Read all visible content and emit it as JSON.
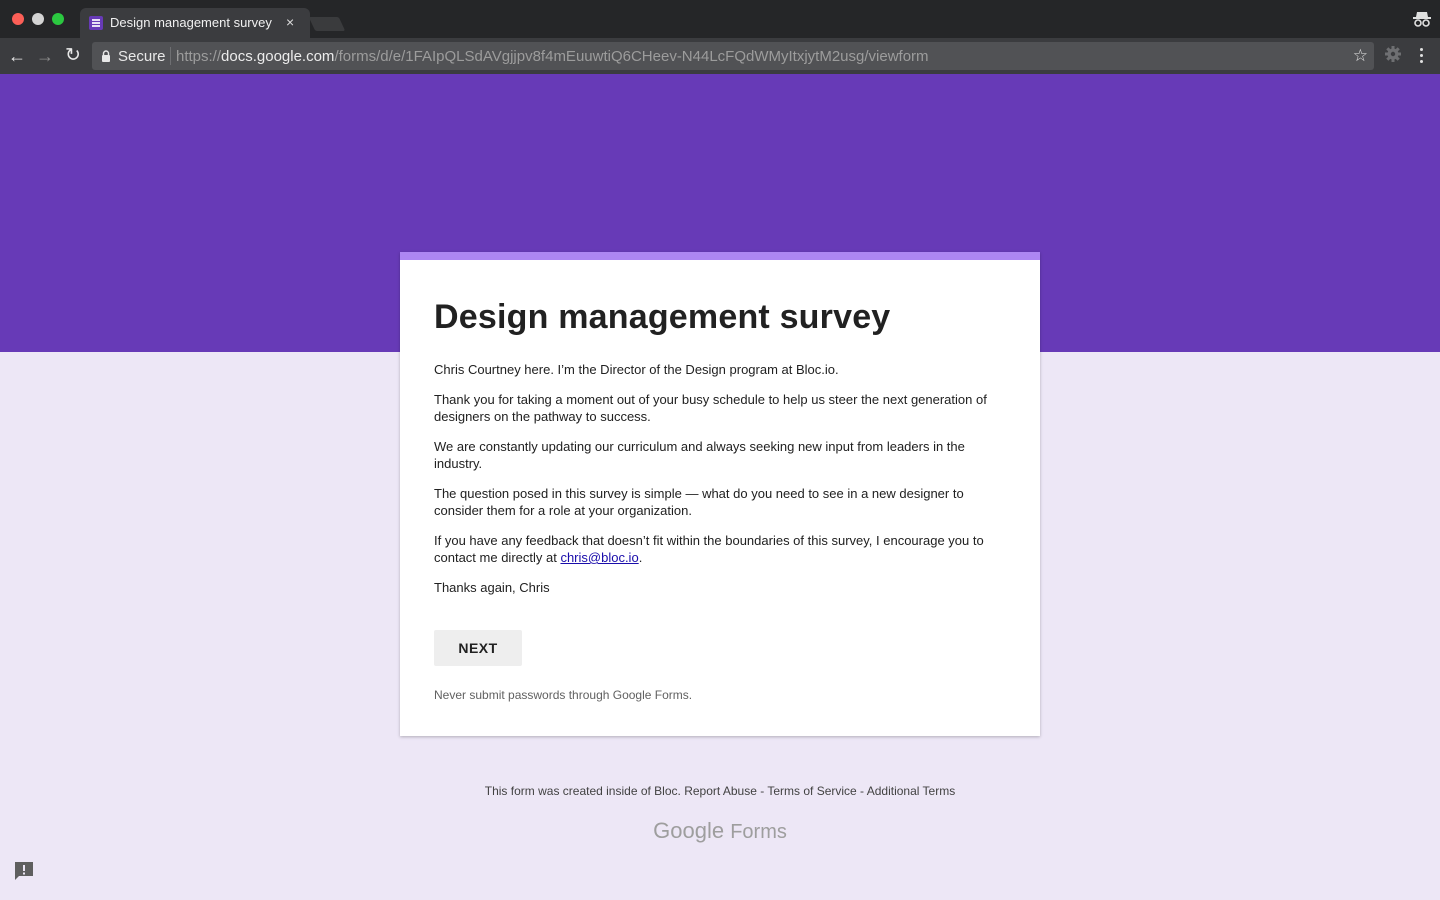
{
  "browser": {
    "tab_title": "Design management survey",
    "tab_close": "×",
    "secure_label": "Secure",
    "url_scheme": "https://",
    "url_host": "docs.google.com",
    "url_path": "/forms/d/e/1FAIpQLSdAVgjjpv8f4mEuuwtiQ6CHeev-N44LcFQdWMyItxjytM2usg/viewform",
    "back_glyph": "←",
    "forward_glyph": "→",
    "reload_glyph": "↻",
    "star_glyph": "☆"
  },
  "theme": {
    "header_color": "#673ab7",
    "accent_color": "#ad86f2",
    "background_color": "#ede7f6"
  },
  "form": {
    "title": "Design management survey",
    "paragraphs": {
      "p1": "Chris Courtney here. I’m the Director of the Design program at Bloc.io.",
      "p2": "Thank you for taking a moment out of your busy schedule to help us steer the next generation of designers on the pathway to success.",
      "p3": "We are constantly updating our curriculum and always seeking new input from leaders in the industry.",
      "p4": "The question posed in this survey is simple — what do you need to see in a new designer to consider them for a role at your organization.",
      "p5_before": "If you have any feedback that doesn’t fit within the boundaries of this survey, I encourage you to contact me directly at ",
      "p5_link": "chris@bloc.io",
      "p5_after": ".",
      "p6": "Thanks again, Chris"
    },
    "next_label": "NEXT",
    "warning": "Never submit passwords through Google Forms."
  },
  "footer": {
    "created_text": "This form was created inside of Bloc.",
    "report_abuse": "Report Abuse",
    "sep1": " - ",
    "terms": "Terms of Service",
    "sep2": " - ",
    "additional_terms": "Additional Terms",
    "logo_google": "Google",
    "logo_forms": "Forms"
  },
  "icons": {
    "tab_favicon": "forms-list-icon",
    "incognito": "incognito-icon",
    "lock": "lock-icon",
    "extension": "gear-icon",
    "menu": "kebab-menu-icon",
    "feedback": "feedback-icon"
  }
}
